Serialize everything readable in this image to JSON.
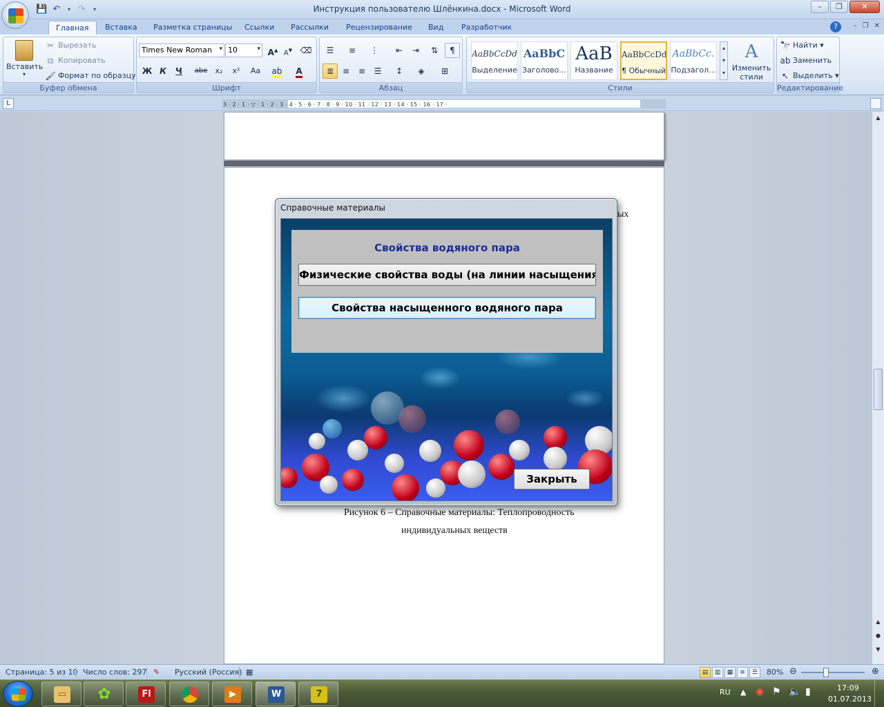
{
  "window": {
    "title": "Инструкция пользователю Шлёнкина.docx - Microsoft Word",
    "controls": [
      "–",
      "❐",
      "✕"
    ]
  },
  "tabs": [
    "Главная",
    "Вставка",
    "Разметка страницы",
    "Ссылки",
    "Рассылки",
    "Рецензирование",
    "Вид",
    "Разработчик"
  ],
  "ribbon": {
    "clipboard": {
      "label": "Буфер обмена",
      "paste": "Вставить",
      "cut": "Вырезать",
      "copy": "Копировать",
      "format_painter": "Формат по образцу"
    },
    "font": {
      "label": "Шрифт",
      "font_name": "Times New Roman",
      "font_size": "10",
      "bold": "Ж",
      "italic": "К",
      "underline": "Ч",
      "strike": "abe",
      "subscript": "x₂",
      "superscript": "x²",
      "case": "Aa"
    },
    "paragraph": {
      "label": "Абзац"
    },
    "styles": {
      "label": "Стили",
      "items": [
        {
          "sample": "AaBbCcDd",
          "name": "Выделение"
        },
        {
          "sample": "AaBbC",
          "name": "Заголово..."
        },
        {
          "sample": "AaB",
          "name": "Название"
        },
        {
          "sample": "AaBbCcDd",
          "name": "¶ Обычный"
        },
        {
          "sample": "AaBbCc.",
          "name": "Подзагол..."
        }
      ],
      "change_styles": "Изменить стили"
    },
    "editing": {
      "label": "Редактирование",
      "find": "Найти",
      "replace": "Заменить",
      "select": "Выделить"
    }
  },
  "ruler": {
    "numbers": "3 · 2 · 1 · ▽ · 1 · 2 · 3 · 4 · 5 · 6 · 7 · 8 · 9 · 10 · 11 · 12 · 13 · 14 · 15 · 16 · 17 ·"
  },
  "document": {
    "partial_text": "ых",
    "caption_line1": "Рисунок 6 – Справочные материалы: Теплопроводность",
    "caption_line2": "индивидуальных веществ"
  },
  "dialog": {
    "title": "Справочные материалы",
    "panel_title": "Свойства водяного пара",
    "btn_physical": "Физические свойства воды (на линии насыщения)",
    "btn_saturated": "Свойства насыщенного водяного пара",
    "close": "Закрыть"
  },
  "statusbar": {
    "page": "Страница: 5 из 10",
    "words": "Число слов: 297",
    "language": "Русский (Россия)",
    "zoom": "80%",
    "zoom_level_percent": 80
  },
  "taskbar": {
    "lang": "RU",
    "time": "17:09",
    "date": "01.07.2013"
  },
  "colors": {
    "ribbon_bg": "#dbe7f5",
    "panel_title": "#1a2b9a",
    "panel_bg": "#c0c0c0",
    "water_blue": "#0d6aa0"
  }
}
